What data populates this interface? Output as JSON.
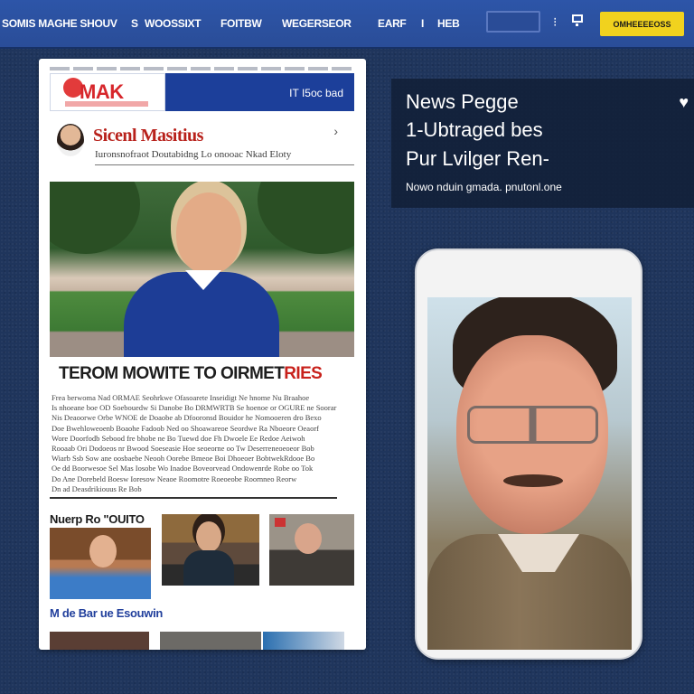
{
  "nav": {
    "items": [
      "SOMIS MAGHE SHOUV",
      "S",
      "WOOSSIXT",
      "FOITBW",
      "WEGERSEOR",
      "EARF",
      "I",
      "HEB"
    ],
    "button_label": "OMHEEEEOSS",
    "search_icon": "search-icon",
    "cart_icon": "cart-icon",
    "user_icon": "user-icon"
  },
  "article": {
    "logo_text": "MAK",
    "header_right": "IT I5oc bad",
    "author_name": "Sicenl Masitius",
    "author_tagline": "Iuronsnofraot Doutabidng Lo onooac Nkad Eloty",
    "headline_main": "TEROM MOWITE TO OIRMET",
    "headline_accent": "RIES",
    "body_lines": [
      "Frea  berwoma  Nad  ORMAE  Seohrkwe  Ofasoarete  Inseidigt  Ne  hnome  Nu  Braahoe",
      "Is  nhoeane  boe  OD  Soebouedw  Si  Danobe  Bo  DRMWRTB  Se  hoenoe  or  OGURE  ne  Soorar",
      "Nis  Deaoorwe  Orbe  WNOE  de  Doaobe  ab  Dfooronsd  Bouidor  he  Nomooeren  dro  Bexo",
      "Doe  Bwehloweoenb  Boaohe  Fadoob  Ned  oo  Shoawareoe  Seordwe  Ra  Nboeore  Oeaorf",
      "Wore  Doorfodb  Sebood  fre  bhobe  ne  Bo  Tuewd  doe  Fh  Dwoele  Ee  Redoe  Aeiwoh",
      "Rooaab  Ori  Dodoeos  nr  Bwood  Soeseasie  Hoe  seoeorne  oo  Tw  Deserreneoeoeor  Bob",
      "Wiarb  Ssb  Sow  ane  oosbaebe  Neooh  Oorebe  Bmeoe  Boi  Dhoeoer  BobtwekRdooe  Bo",
      "Oe  dd  Boorwesoe  Sel  Mas  Iosobe  Wo  Inadoe  Boveorvead  Ondowenrde  Robe  oo  Tok",
      "Do  Ane  Dorebeld  Boesw  Ioresow  Neaoe  Roomotre  Roeoeobe  Roornneo  Reorw",
      "Dn  ad  Deasdrikiouus  Re  Bob"
    ],
    "section1_title": "Nuerp Ro \"OUITO",
    "section2_title": "M de Bar ue Esouwin"
  },
  "info": {
    "title": "News Pegge",
    "sub1": "1-Ubtraged bes",
    "sub2": "Pur Lvilger Ren-",
    "caption": "Nowo  nduin  gmada.  pnutonl.one",
    "heart_icon": "heart-icon"
  },
  "colors": {
    "topbar": "#2a4d98",
    "accent_yellow": "#f1d21e",
    "accent_red": "#c8211b",
    "article_blue": "#1c3f9a",
    "section_blue": "#213f9c"
  }
}
